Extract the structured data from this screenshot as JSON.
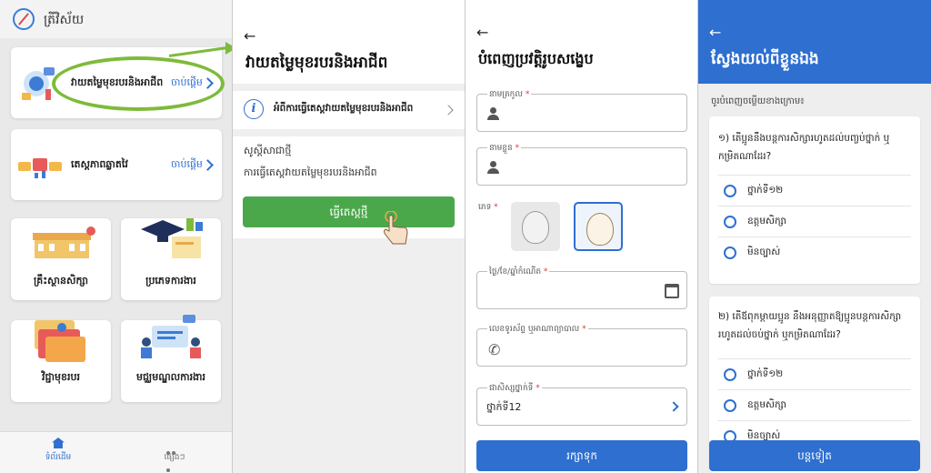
{
  "screen1": {
    "title": "ត្រីវិស័យ",
    "career_card": {
      "label": "វាយតម្លៃមុខរបរនិងអាជីព",
      "start": "ចាប់ផ្តើម"
    },
    "personality_card": {
      "label": "តេស្តភាពឆ្លាតវៃ",
      "start": "ចាប់ផ្តើម"
    },
    "tiles": [
      {
        "label": "គ្រឹះស្ថានសិក្សា"
      },
      {
        "label": "ប្រភេទការងារ"
      },
      {
        "label": "វិជ្ជាមុខរបរ"
      },
      {
        "label": "មជ្ឈមណ្ឌលការងារ"
      }
    ],
    "nav": {
      "home": "ទំព័រដើម",
      "other": "ផ្សេងៗ"
    },
    "highlight_color": "#7dbb3a"
  },
  "screen2": {
    "back": "←",
    "title": "វាយតម្លៃមុខរបរនិងអាជីព",
    "info_label": "អំពីការធ្វើតេស្តវាយតម្លៃមុខរបរនិងអាជីព",
    "welcome": "សូស្តីសាជាថ្មី",
    "welcome_sub": "ការធ្វើតេស្តវាយតម្លៃមុខរបរនិងអាជីព",
    "start_button": "ធ្វើតេស្តថ្មី"
  },
  "screen3": {
    "back": "←",
    "title": "បំពេញប្រវត្តិរូបសង្ខេប",
    "surname_label": "នាមត្រកូល",
    "given_name_label": "នាមខ្លួន",
    "gender_label": "ភេទ",
    "dob_label": "ថ្ងៃ/ខែ/ឆ្នាំកំណើត",
    "phone_label": "លេខទូរស័ព្ទ ឬអាណាព្យាបាល",
    "grade_label": "ជាសិស្សថ្នាក់ទី",
    "grade_value": "ថ្នាក់ទី12",
    "required_mark": "*",
    "save_button": "រក្សាទុក"
  },
  "screen4": {
    "back": "←",
    "title": "ស្វែងយល់ពីខ្លួនឯង",
    "instruction": "ចូរបំពេញចម្លើយខាងក្រោម៖",
    "questions": [
      {
        "text": "១) តើប្អូននឹងបន្តការសិក្សារហូតដល់បញ្ចប់ថ្នាក់ ឬកម្រិតណាដែរ?",
        "options": [
          "ថ្នាក់ទី១២",
          "ឧត្តមសិក្សា",
          "មិនច្បាស់"
        ]
      },
      {
        "text": "២) តើឪពុកម្តាយប្អូន នឹងអនុញ្ញាតឱ្យប្អូនបន្តការសិក្សារហូតដល់ចប់ថ្នាក់ ឬកម្រិតណាដែរ?",
        "options": [
          "ថ្នាក់ទី១២",
          "ឧត្តមសិក្សា",
          "មិនច្បាស់"
        ]
      }
    ],
    "continue_button": "បន្តទៀត"
  },
  "colors": {
    "primary": "#2e6fd0",
    "green": "#4aa84a"
  }
}
